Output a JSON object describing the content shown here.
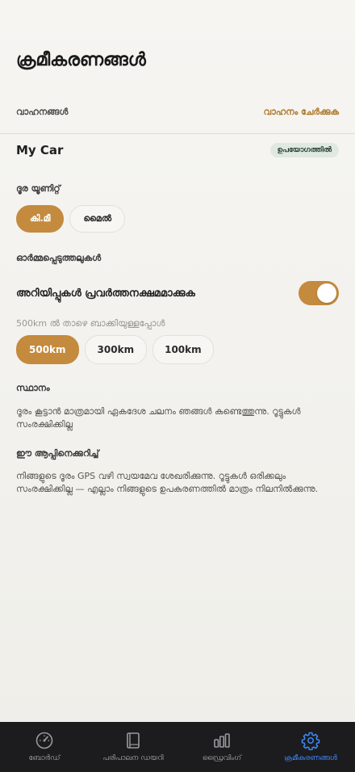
{
  "page": {
    "title": "ക്രമീകരണങ്ങൾ"
  },
  "vehicles": {
    "label": "വാഹനങ്ങൾ",
    "add_link": "വാഹനം ചേർക്കുക",
    "items": [
      {
        "name": "My Car",
        "badge": "ഉപയോഗത്തിൽ"
      }
    ]
  },
  "distance_unit": {
    "label": "ദൂര യൂണിറ്റ്",
    "options": [
      "കി.മീ",
      "മൈൽ"
    ],
    "selected": "കി.മീ"
  },
  "reminders": {
    "label": "ഓർമ്മപ്പെടുത്തലുകൾ",
    "toggle_label": "അറിയിപ്പുകൾ പ്രവർത്തനക്ഷമമാക്കുക",
    "toggle_on": true,
    "hint": "500km ൽ താഴെ ബാക്കിയുള്ളപ്പോൾ",
    "thresholds": [
      "500km",
      "300km",
      "100km"
    ],
    "selected": "500km"
  },
  "location": {
    "label": "സ്ഥാനം",
    "text": "ദൂരം കൂട്ടാൻ മാത്രമായി ഏകദേശ ചലനം ഞങ്ങൾ കണ്ടെത്തുന്നു. റൂട്ടുകൾ സംരക്ഷിക്കില്ല"
  },
  "about": {
    "label": "ഈ ആപ്പിനെക്കുറിച്ച്",
    "text": "നിങ്ങളുടെ ദൂരം GPS വഴി സ്വയമേവ ശേഖരിക്കുന്നു. റൂട്ടുകൾ ഒരിക്കലും സംരക്ഷിക്കില്ല — എല്ലാം നിങ്ങളുടെ ഉപകരണത്തിൽ മാത്രം നിലനിൽക്കുന്നു."
  },
  "tabbar": {
    "items": [
      {
        "label": "ബോർഡ്",
        "icon": "gauge-icon"
      },
      {
        "label": "പരിപാലന ഡയറി",
        "icon": "book-icon"
      },
      {
        "label": "ഡ്രൈവിംഗ്",
        "icon": "bar-chart-icon"
      },
      {
        "label": "ക്രമീകരണങ്ങൾ",
        "icon": "gear-icon"
      }
    ],
    "active_index": 3
  },
  "colors": {
    "accent": "#c48a3e",
    "link": "#b07a2e",
    "tab_active": "#3d8bff",
    "tabbar_bg": "#1c1c1e"
  }
}
